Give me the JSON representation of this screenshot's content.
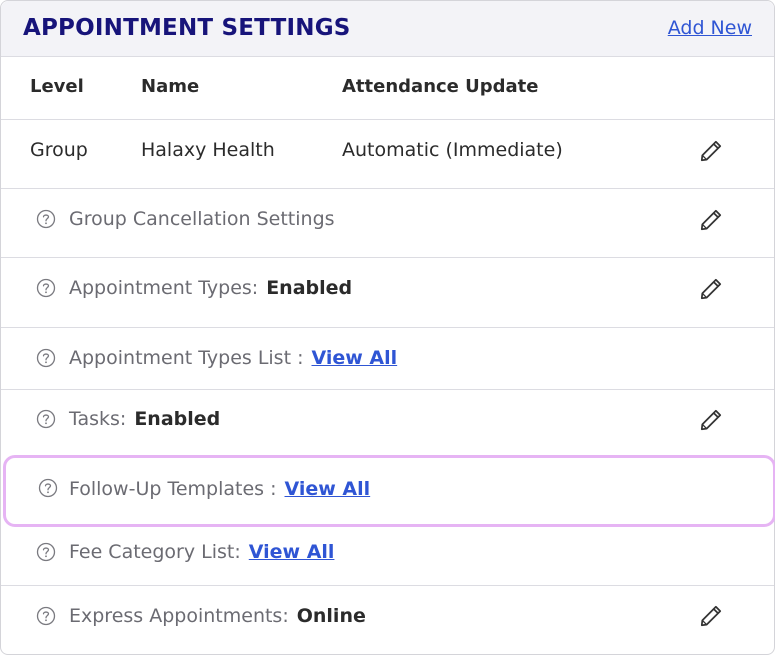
{
  "header": {
    "title": "APPOINTMENT SETTINGS",
    "add_new_label": "Add New"
  },
  "columns": {
    "level": "Level",
    "name": "Name",
    "attendance": "Attendance Update"
  },
  "group_row": {
    "level": "Group",
    "name": "Halaxy Health",
    "attendance": "Automatic (Immediate)"
  },
  "settings": [
    {
      "label": "Group Cancellation Settings",
      "value": "",
      "link": "",
      "editable": true
    },
    {
      "label": "Appointment Types:",
      "value": "Enabled",
      "link": "",
      "editable": true
    },
    {
      "label": "Appointment Types List :",
      "value": "",
      "link": "View All",
      "editable": false
    },
    {
      "label": "Tasks:",
      "value": "Enabled",
      "link": "",
      "editable": true
    },
    {
      "label": "Follow-Up Templates :",
      "value": "",
      "link": "View All",
      "editable": false,
      "highlighted": true
    },
    {
      "label": "Fee Category List:",
      "value": "",
      "link": "View All",
      "editable": false
    },
    {
      "label": "Express Appointments:",
      "value": "Online",
      "link": "",
      "editable": true
    }
  ],
  "icons": {
    "help": "question-circle-icon",
    "edit": "pencil-icon"
  },
  "colors": {
    "title": "#17147a",
    "link": "#2f55d4",
    "highlight": "#e6b4f4",
    "header_bg": "#f3f3f7"
  }
}
